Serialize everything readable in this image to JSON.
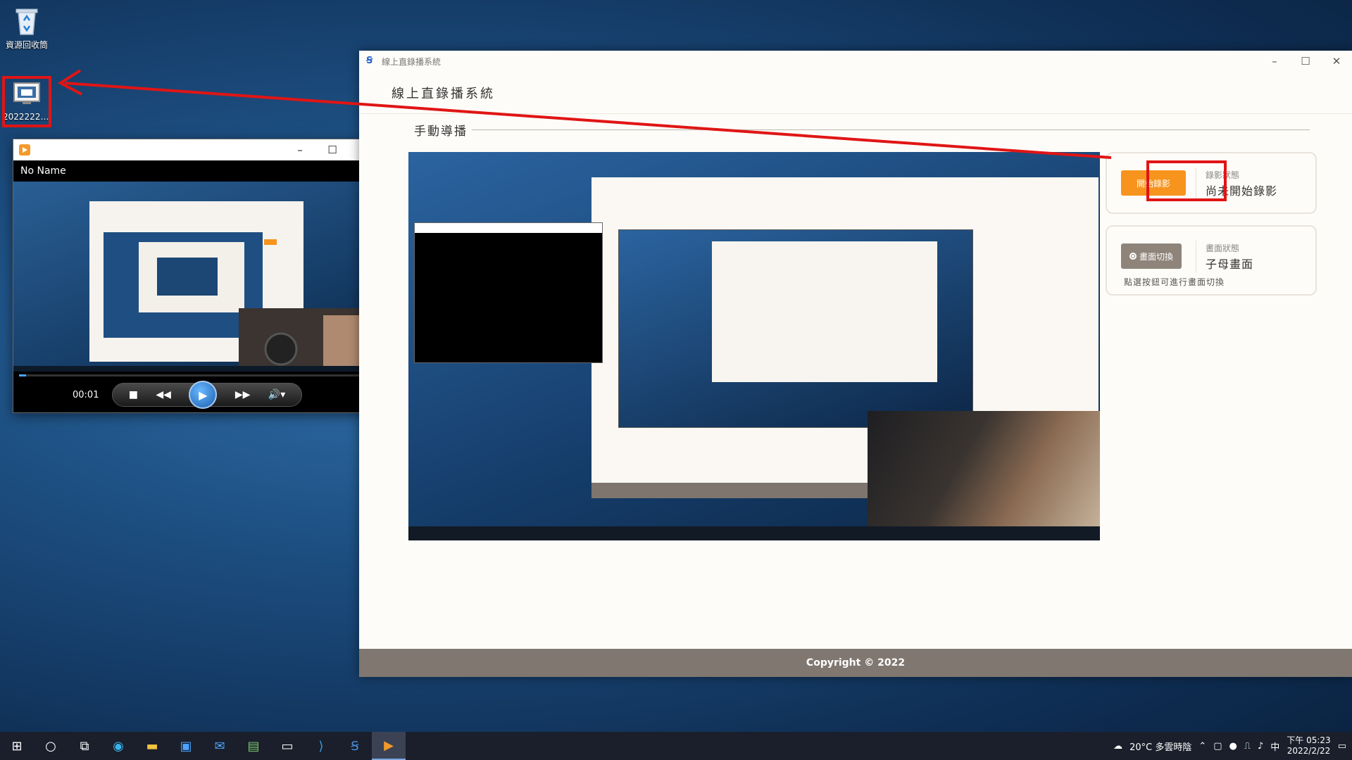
{
  "desktop": {
    "recycle_bin_label": "資源回收筒",
    "video_file_label": "20222221..."
  },
  "media_player": {
    "file_name": "No Name",
    "time": "00:01",
    "progress": 0.02
  },
  "main_window": {
    "window_title": "線上直錄播系統",
    "app_title": "線上直錄播系統",
    "section_title": "手動導播",
    "record_card": {
      "button_label": "開始錄影",
      "status_label": "錄影狀態",
      "status_value": "尚未開始錄影"
    },
    "switch_card": {
      "button_label": "畫面切換",
      "status_label": "畫面狀態",
      "status_value": "子母畫面",
      "hint": "點選按鈕可進行畫面切換"
    },
    "footer": "Copyright © 2022"
  },
  "taskbar": {
    "weather": "20°C 多雲時陰",
    "ime": "中",
    "time": "下午 05:23",
    "date": "2022/2/22"
  },
  "colors": {
    "accent_orange": "#f7941d",
    "switch_button": "#8f847a",
    "footer_bg": "#7f7770",
    "annotation_red": "#e01515"
  }
}
